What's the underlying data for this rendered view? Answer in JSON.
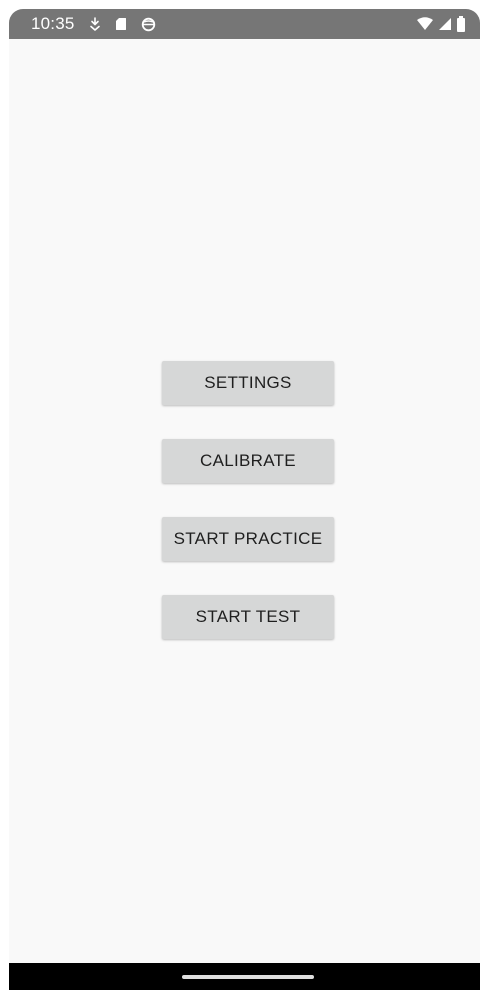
{
  "status_bar": {
    "time": "10:35",
    "left_icons": [
      "download-icon",
      "sd-card-icon",
      "sync-icon"
    ],
    "right_icons": [
      "wifi-icon",
      "signal-icon",
      "battery-icon"
    ]
  },
  "main": {
    "buttons": [
      {
        "label": "SETTINGS"
      },
      {
        "label": "CALIBRATE"
      },
      {
        "label": "START PRACTICE"
      },
      {
        "label": "START TEST"
      }
    ]
  },
  "colors": {
    "status_bar_bg": "#767676",
    "screen_bg": "#f9f9f9",
    "button_bg": "#d6d7d7",
    "button_text": "#1f1f1f",
    "nav_bar_bg": "#000000"
  }
}
